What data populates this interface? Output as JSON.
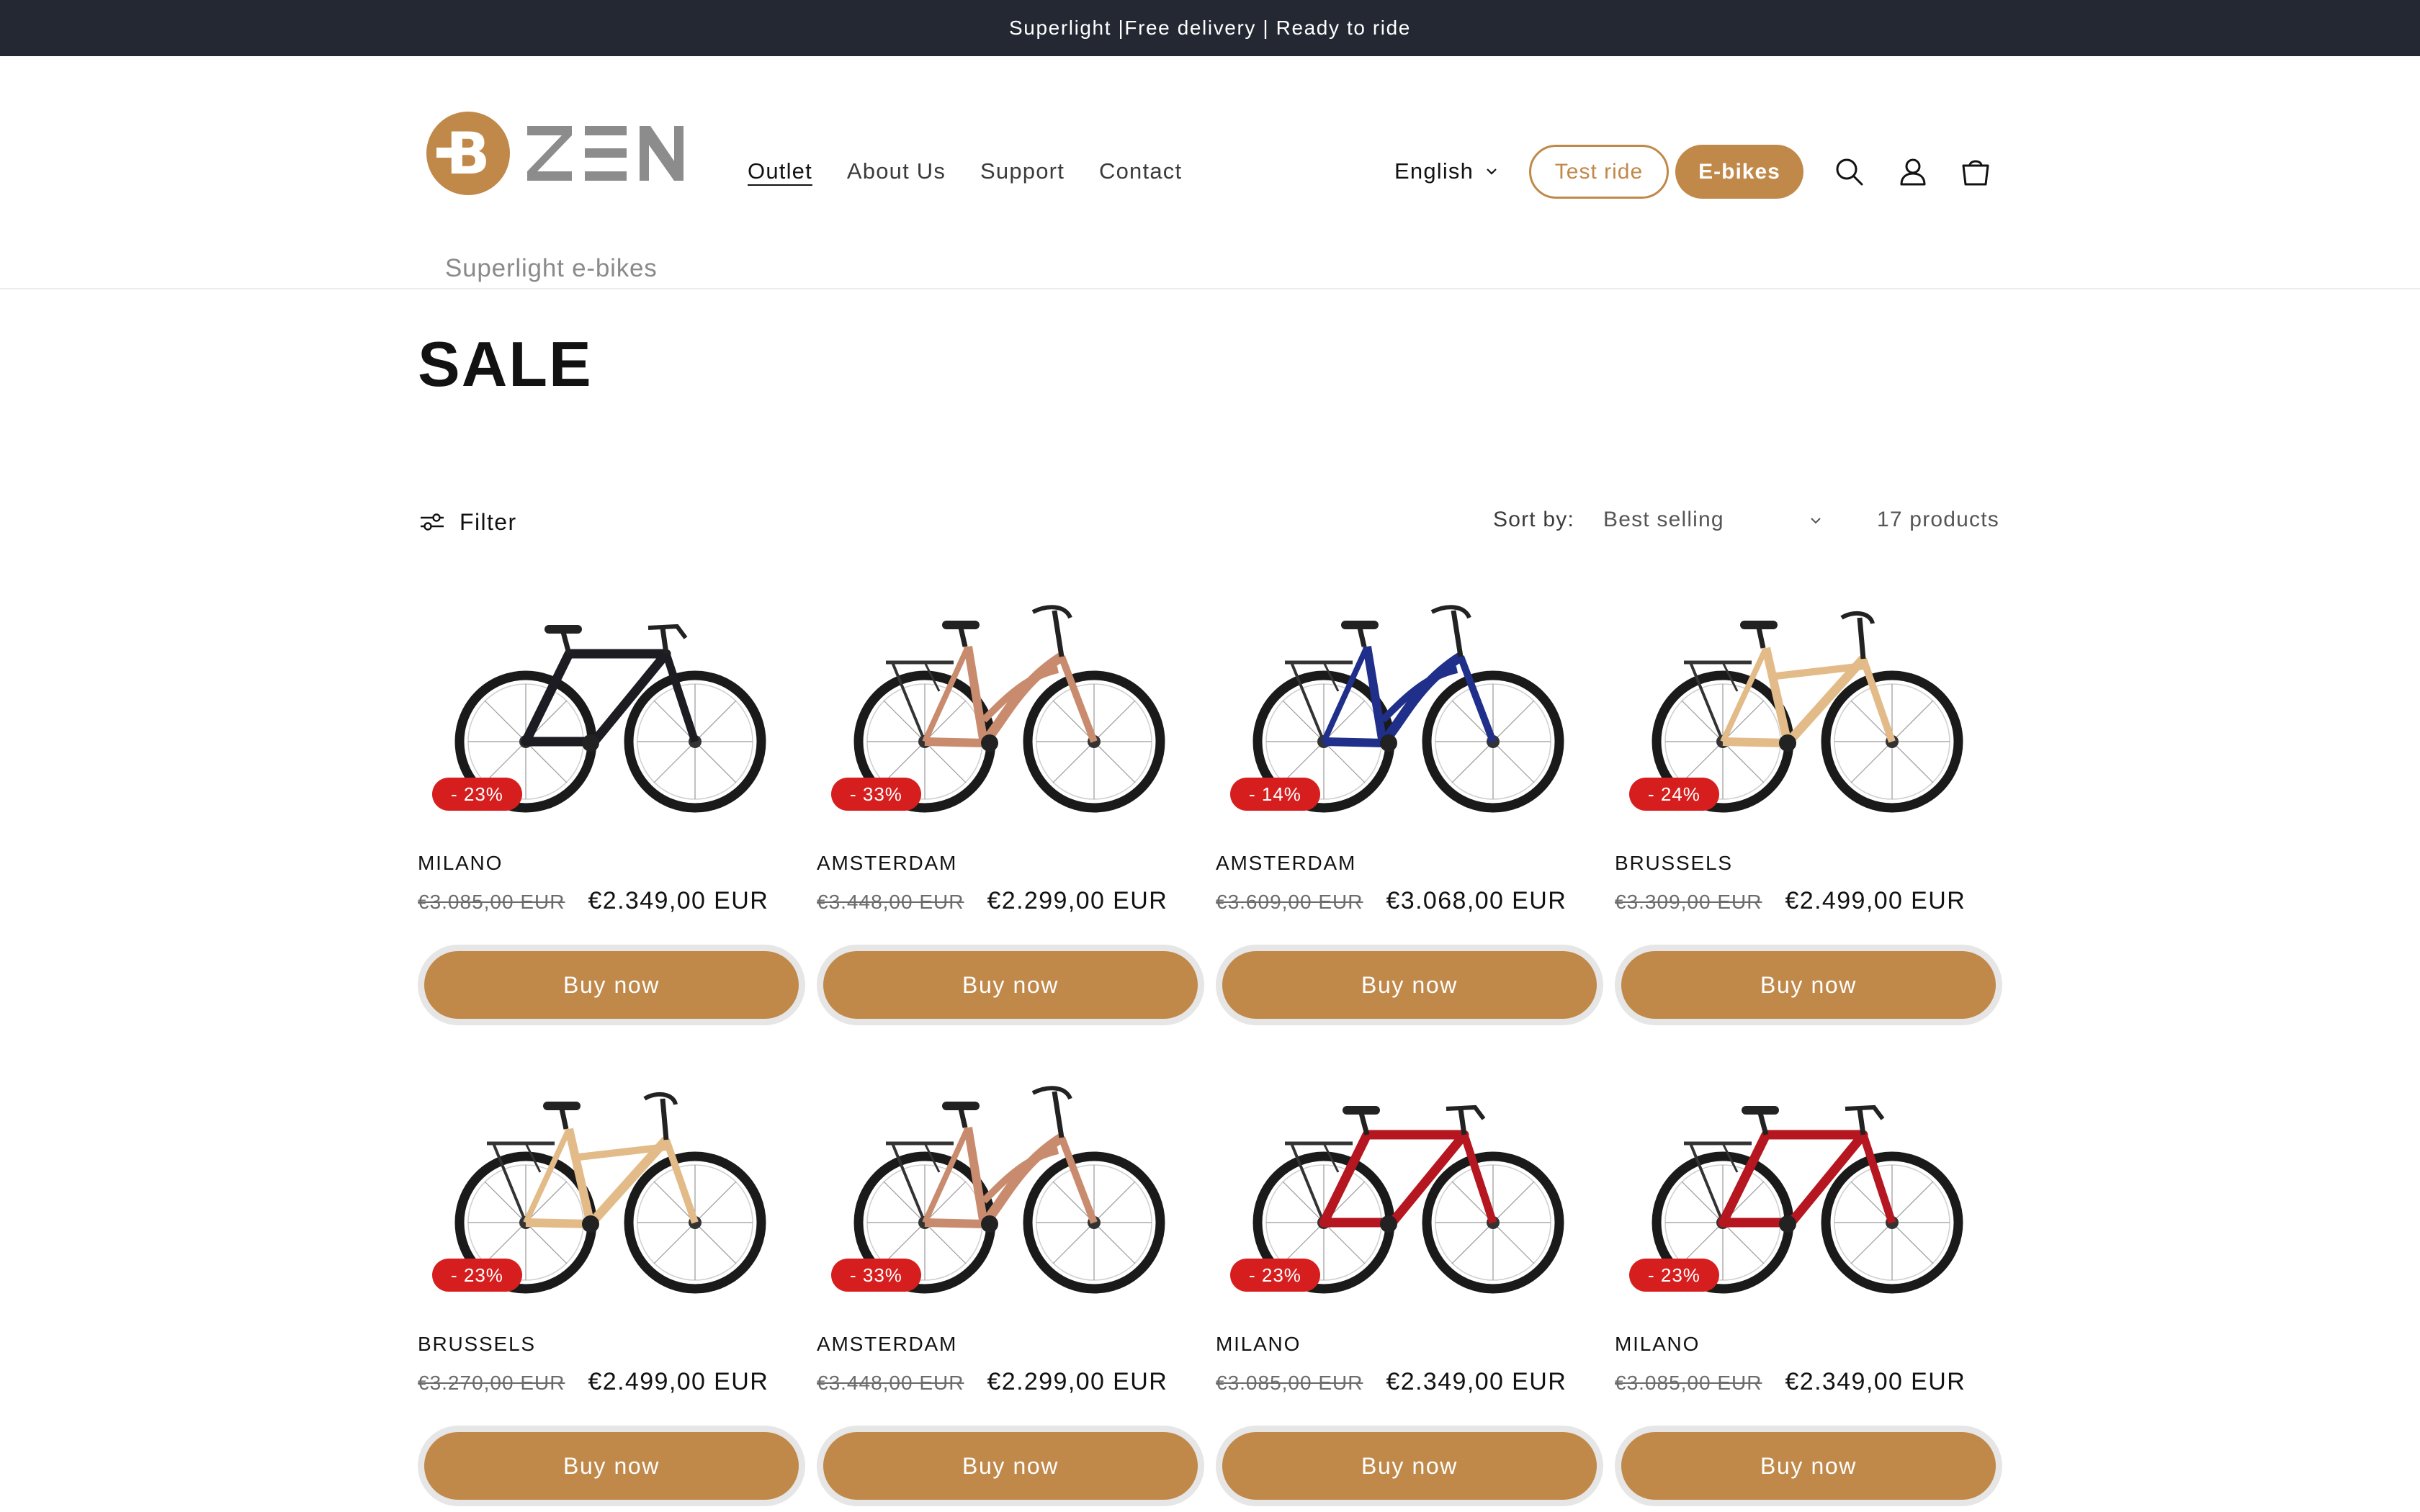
{
  "announcement": "Superlight |Free delivery | Ready to ride",
  "brand": {
    "tagline": "Superlight e-bikes",
    "logo_text": "ZEN",
    "logo_mark": "B",
    "accent_color": "#c0894a"
  },
  "nav": {
    "items": [
      "Outlet",
      "About Us",
      "Support",
      "Contact"
    ],
    "active": "Outlet"
  },
  "header": {
    "language": "English",
    "test_ride_label": "Test ride",
    "ebikes_label": "E-bikes",
    "icons": [
      "search-icon",
      "account-icon",
      "cart-icon"
    ]
  },
  "page": {
    "title": "SALE"
  },
  "toolbar": {
    "filter_label": "Filter",
    "sort_label": "Sort by:",
    "sort_value": "Best selling",
    "product_count": "17 products"
  },
  "products": [
    {
      "name": "MILANO",
      "badge": "- 23%",
      "old_price": "€3.085,00 EUR",
      "new_price": "€2.349,00 EUR",
      "buy_label": "Buy now",
      "frame_color": "#1c1c22",
      "style": "sport"
    },
    {
      "name": "AMSTERDAM",
      "badge": "- 33%",
      "old_price": "€3.448,00 EUR",
      "new_price": "€2.299,00 EUR",
      "buy_label": "Buy now",
      "frame_color": "#c98b6e",
      "style": "step"
    },
    {
      "name": "AMSTERDAM",
      "badge": "- 14%",
      "old_price": "€3.609,00 EUR",
      "new_price": "€3.068,00 EUR",
      "buy_label": "Buy now",
      "frame_color": "#1f2f8a",
      "style": "step"
    },
    {
      "name": "BRUSSELS",
      "badge": "- 24%",
      "old_price": "€3.309,00 EUR",
      "new_price": "€2.499,00 EUR",
      "buy_label": "Buy now",
      "frame_color": "#e2bb88",
      "style": "mixte"
    },
    {
      "name": "BRUSSELS",
      "badge": "- 23%",
      "old_price": "€3.270,00 EUR",
      "new_price": "€2.499,00 EUR",
      "buy_label": "Buy now",
      "frame_color": "#e2bb88",
      "style": "mixte"
    },
    {
      "name": "AMSTERDAM",
      "badge": "- 33%",
      "old_price": "€3.448,00 EUR",
      "new_price": "€2.299,00 EUR",
      "buy_label": "Buy now",
      "frame_color": "#c98b6e",
      "style": "step"
    },
    {
      "name": "MILANO",
      "badge": "- 23%",
      "old_price": "€3.085,00 EUR",
      "new_price": "€2.349,00 EUR",
      "buy_label": "Buy now",
      "frame_color": "#b5161f",
      "style": "sport-rack"
    },
    {
      "name": "MILANO",
      "badge": "- 23%",
      "old_price": "€3.085,00 EUR",
      "new_price": "€2.349,00 EUR",
      "buy_label": "Buy now",
      "frame_color": "#b5161f",
      "style": "sport-rack"
    }
  ]
}
